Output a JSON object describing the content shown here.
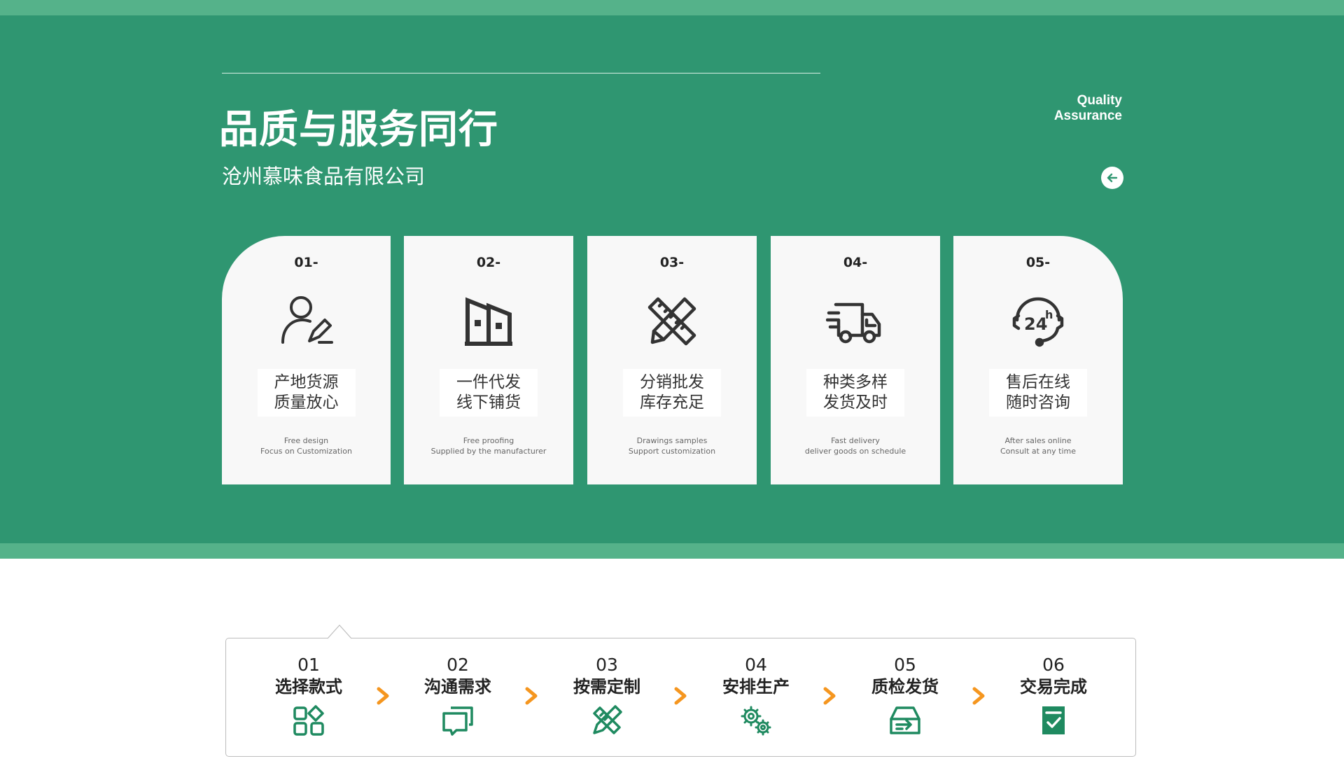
{
  "hero": {
    "title": "品质与服务同行",
    "company": "沧州慕味食品有限公司",
    "badge_line1": "Quality",
    "badge_line2": "Assurance",
    "back_icon": "arrow-left-icon"
  },
  "cards": [
    {
      "num": "01-",
      "title1": "产地货源",
      "title2": "质量放心",
      "sub1": "Free design",
      "sub2": "Focus on Customization",
      "icon": "user-edit-icon"
    },
    {
      "num": "02-",
      "title1": "一件代发",
      "title2": "线下铺货",
      "sub1": "Free proofing",
      "sub2": "Supplied by the manufacturer",
      "icon": "building-icon"
    },
    {
      "num": "03-",
      "title1": "分销批发",
      "title2": "库存充足",
      "sub1": "Drawings  samples",
      "sub2": "Support customization",
      "icon": "ruler-pencil-icon"
    },
    {
      "num": "04-",
      "title1": "种类多样",
      "title2": "发货及时",
      "sub1": "Fast delivery",
      "sub2": "deliver goods on schedule",
      "icon": "truck-icon"
    },
    {
      "num": "05-",
      "title1": "售后在线",
      "title2": "随时咨询",
      "sub1": "After sales online",
      "sub2": "Consult at any time",
      "icon": "24h-support-icon"
    }
  ],
  "flow": {
    "steps": [
      {
        "num": "01",
        "label": "选择款式",
        "icon": "grid-shapes-icon"
      },
      {
        "num": "02",
        "label": "沟通需求",
        "icon": "chat-icon"
      },
      {
        "num": "03",
        "label": "按需定制",
        "icon": "pencil-ruler-icon"
      },
      {
        "num": "04",
        "label": "安排生产",
        "icon": "gears-icon"
      },
      {
        "num": "05",
        "label": "质检发货",
        "icon": "inbox-arrow-icon"
      },
      {
        "num": "06",
        "label": "交易完成",
        "icon": "checklist-icon"
      }
    ],
    "arrow_icon": "chevron-right-icon"
  },
  "colors": {
    "hero_green": "#2f9671",
    "band_green": "#55b28a",
    "icon_green": "#1f8a60",
    "arrow_orange": "#f5961f",
    "card_bg": "#f8f8f8"
  }
}
